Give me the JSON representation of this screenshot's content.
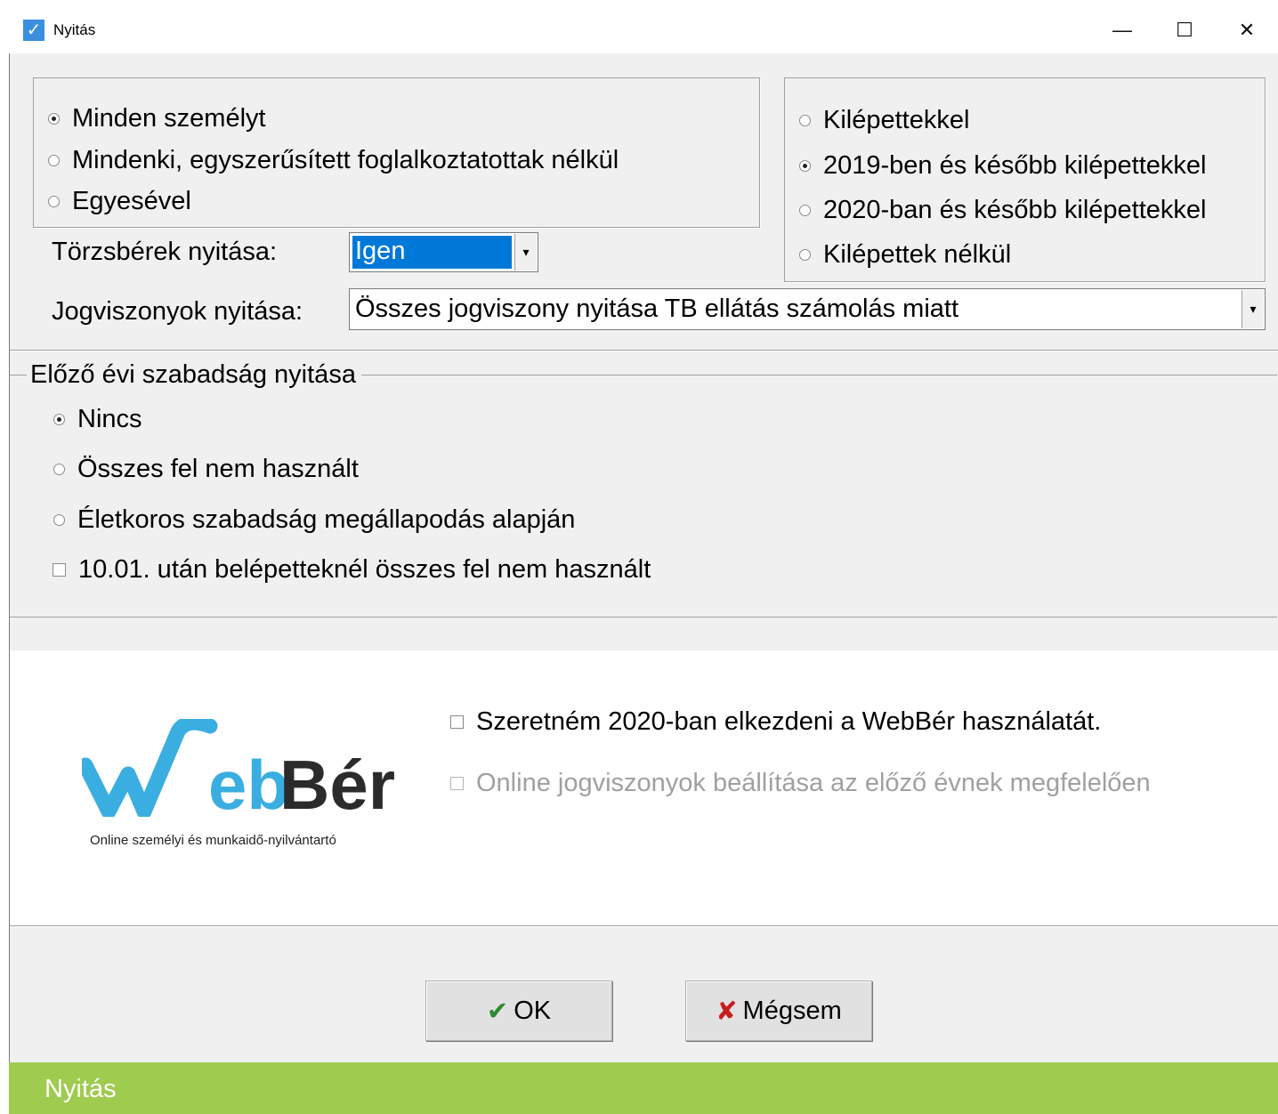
{
  "window": {
    "title": "Nyitás",
    "app_check": "✓",
    "minimize": "—",
    "maximize": "☐",
    "close": "✕"
  },
  "scope_group": {
    "options": [
      {
        "label": "Minden személyt",
        "selected": true
      },
      {
        "label": "Mindenki, egyszerűsített foglalkoztatottak nélkül",
        "selected": false
      },
      {
        "label": "Egyesével",
        "selected": false
      }
    ]
  },
  "exits_group": {
    "options": [
      {
        "label": "Kilépettekkel",
        "selected": false
      },
      {
        "label": "2019-ben és később kilépettekkel",
        "selected": true
      },
      {
        "label": "2020-ban és később kilépettekkel",
        "selected": false
      },
      {
        "label": "Kilépettek nélkül",
        "selected": false
      }
    ]
  },
  "base_wages": {
    "label": "Törzsbérek nyitása:",
    "value": "Igen",
    "arrow": "▾"
  },
  "legal_relations": {
    "label": "Jogviszonyok nyitása:",
    "value": "Összes jogviszony nyitása TB ellátás számolás miatt",
    "arrow": "▾"
  },
  "leave_group": {
    "title": "Előző évi szabadság nyitása",
    "options": [
      {
        "label": "Nincs",
        "selected": true
      },
      {
        "label": "Összes fel nem használt",
        "selected": false
      },
      {
        "label": "Életkoros szabadság megállapodás alapján",
        "selected": false
      }
    ],
    "checkbox_label": "10.01. után belépetteknél összes fel nem használt"
  },
  "webber": {
    "logo_web": "Web",
    "logo_ber": "Bér",
    "tagline": "Online személyi és munkaidő-nyilvántartó",
    "start_checkbox": "Szeretném 2020-ban elkezdeni a WebBér használatát.",
    "online_checkbox": "Online jogviszonyok beállítása az előző évnek megfelelően"
  },
  "buttons": {
    "ok_icon": "✔",
    "ok_label": "OK",
    "cancel_icon": "✘",
    "cancel_label": "Mégsem"
  },
  "footer": {
    "label": "Nyitás"
  },
  "colors": {
    "accent_green": "#9fcb4f",
    "selection_blue": "#0078d7",
    "logo_blue": "#3aaee0",
    "logo_dark": "#2b2b2b"
  }
}
